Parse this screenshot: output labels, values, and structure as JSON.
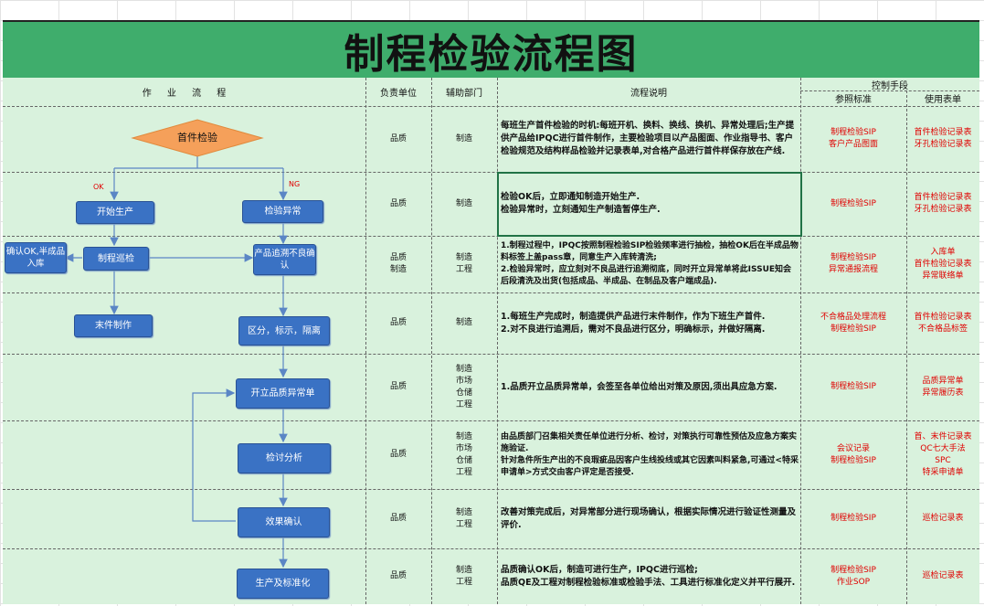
{
  "title": "制程检验流程图",
  "headers": {
    "flow": "作 业 流 程",
    "owner": "负责单位",
    "assist": "辅助部门",
    "desc": "流程说明",
    "control": "控制手段",
    "ref": "参照标准",
    "form": "使用表单"
  },
  "flow": {
    "start": "首件检验",
    "ok": "OK",
    "ng": "NG",
    "begin_production": "开始生产",
    "inspect_abnormal": "检验异常",
    "confirm_ok": "确认OK,半成品入库",
    "process_patrol": "制程巡检",
    "trace_confirm": "产品追溯不良确认",
    "final_making": "末件制作",
    "isolate": "区分，标示，隔离",
    "open_report": "开立品质异常单",
    "review": "检讨分析",
    "effect_confirm": "效果确认",
    "standardize": "生产及标准化"
  },
  "rows": [
    {
      "owner": "品质",
      "assist": "制造",
      "desc": "每班生产首件检验的时机:每班开机、换料、换线、换机、异常处理后;生产提供产品给IPQC进行首件制作，主要检验项目以产品图面、作业指导书、客户检验规范及结构样品检验并记录表单,对合格产品进行首件样保存放在产线.",
      "ref": "制程检验SIP\n客户产品图面",
      "form": "首件检验记录表\n牙孔检验记录表"
    },
    {
      "owner": "品质",
      "assist": "制造",
      "desc": "检验OK后，立即通知制造开始生产.\n检验异常时，立刻通知生产制造暂停生产.",
      "ref": "制程检验SIP",
      "form": "首件检验记录表\n牙孔检验记录表"
    },
    {
      "owner": "品质\n制造",
      "assist": "制造\n工程",
      "desc": "1.制程过程中，IPQC按照制程检验SIP检验频率进行抽检，抽检OK后在半成品物料标签上盖pass章，同意生产入库转清洗;\n2.检验异常时，应立刻对不良品进行追溯彻底，同时开立异常单将此ISSUE知会后段清洗及出货(包括成品、半成品、在制品及客户端成品).",
      "ref": "制程检验SIP\n异常通报流程",
      "form": "入库单\n首件检验记录表\n异常联络单"
    },
    {
      "owner": "品质",
      "assist": "制造",
      "desc": "1.每班生产完成时，制造提供产品进行末件制作，作为下班生产首件.\n2.对不良进行追溯后，需对不良品进行区分，明确标示，并做好隔离.",
      "ref": "不合格品处理流程\n制程检验SIP",
      "form": "首件检验记录表\n不合格品标签"
    },
    {
      "owner": "品质",
      "assist": "制造\n市场\n仓储\n工程",
      "desc": "1.品质开立品质异常单，会签至各单位给出对策及原因,须出具应急方案.",
      "ref": "制程检验SIP",
      "form": "品质异常单\n异常履历表"
    },
    {
      "owner": "品质",
      "assist": "制造\n市场\n仓储\n工程",
      "desc": "由品质部门召集相关责任单位进行分析、检讨，对策执行可靠性预估及应急方案实施验证.\n针对急件所生产出的不良瑕疵品因客户生线投线或其它因素叫料紧急,可通过<特采申请单>方式交由客户评定是否接受.",
      "ref": "会议记录\n制程检验SIP",
      "form": "首、末件记录表\nQC七大手法\nSPC\n特采申请单"
    },
    {
      "owner": "品质",
      "assist": "制造\n工程",
      "desc": "改善对策完成后，对异常部分进行现场确认，根据实际情况进行验证性测量及评价.",
      "ref": "制程检验SIP",
      "form": "巡检记录表"
    },
    {
      "owner": "品质",
      "assist": "制造\n工程",
      "desc": "品质确认OK后，制造可进行生产，IPQC进行巡检;\n品质QE及工程对制程检验标准或检验手法、工具进行标准化定义并平行展开.",
      "ref": "制程检验SIP\n作业SOP",
      "form": "巡检记录表"
    }
  ],
  "colors": {
    "title_bg": "#3fad6c",
    "sheet_bg": "#d9f2dd",
    "box_fill": "#3a72c4",
    "diamond_fill": "#f5a05a",
    "control_text": "#e00000"
  }
}
